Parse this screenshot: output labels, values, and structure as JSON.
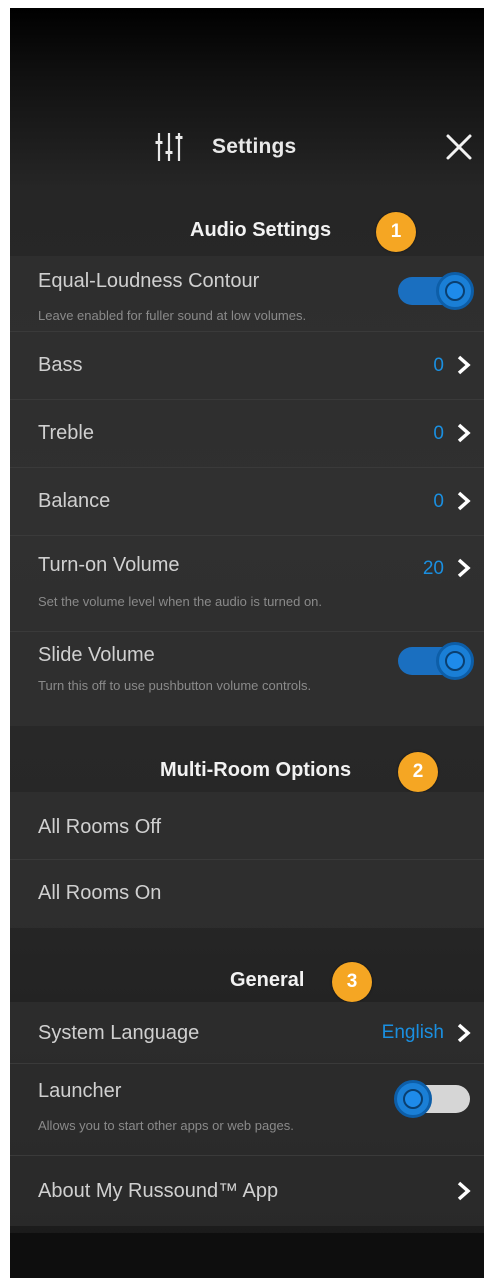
{
  "header": {
    "title": "Settings",
    "icon": "sliders-icon",
    "close_icon": "close-icon"
  },
  "sections": {
    "audio": {
      "title": "Audio Settings",
      "badge": "1",
      "rows": {
        "equal_loudness": {
          "label": "Equal-Loudness Contour",
          "sub": "Leave enabled for fuller sound at low volumes.",
          "toggle_on": true
        },
        "bass": {
          "label": "Bass",
          "value": "0"
        },
        "treble": {
          "label": "Treble",
          "value": "0"
        },
        "balance": {
          "label": "Balance",
          "value": "0"
        },
        "turn_on_volume": {
          "label": "Turn-on Volume",
          "value": "20",
          "sub": "Set the volume level when the audio is turned on."
        },
        "slide_volume": {
          "label": "Slide Volume",
          "sub": "Turn this off to use pushbutton volume controls.",
          "toggle_on": true
        }
      }
    },
    "multiroom": {
      "title": "Multi-Room Options",
      "badge": "2",
      "rows": {
        "all_off": {
          "label": "All Rooms Off"
        },
        "all_on": {
          "label": "All Rooms On"
        }
      }
    },
    "general": {
      "title": "General",
      "badge": "3",
      "rows": {
        "language": {
          "label": "System Language",
          "value": "English"
        },
        "launcher": {
          "label": "Launcher",
          "sub": "Allows you to start other apps or web pages.",
          "toggle_on": false
        },
        "about": {
          "label": "About My Russound™ App"
        }
      }
    }
  },
  "colors": {
    "accent": "#1a8fe0",
    "badge": "#f5a623",
    "toggle_on": "#1a6fc0",
    "toggle_off_track": "#d6d6d6"
  }
}
